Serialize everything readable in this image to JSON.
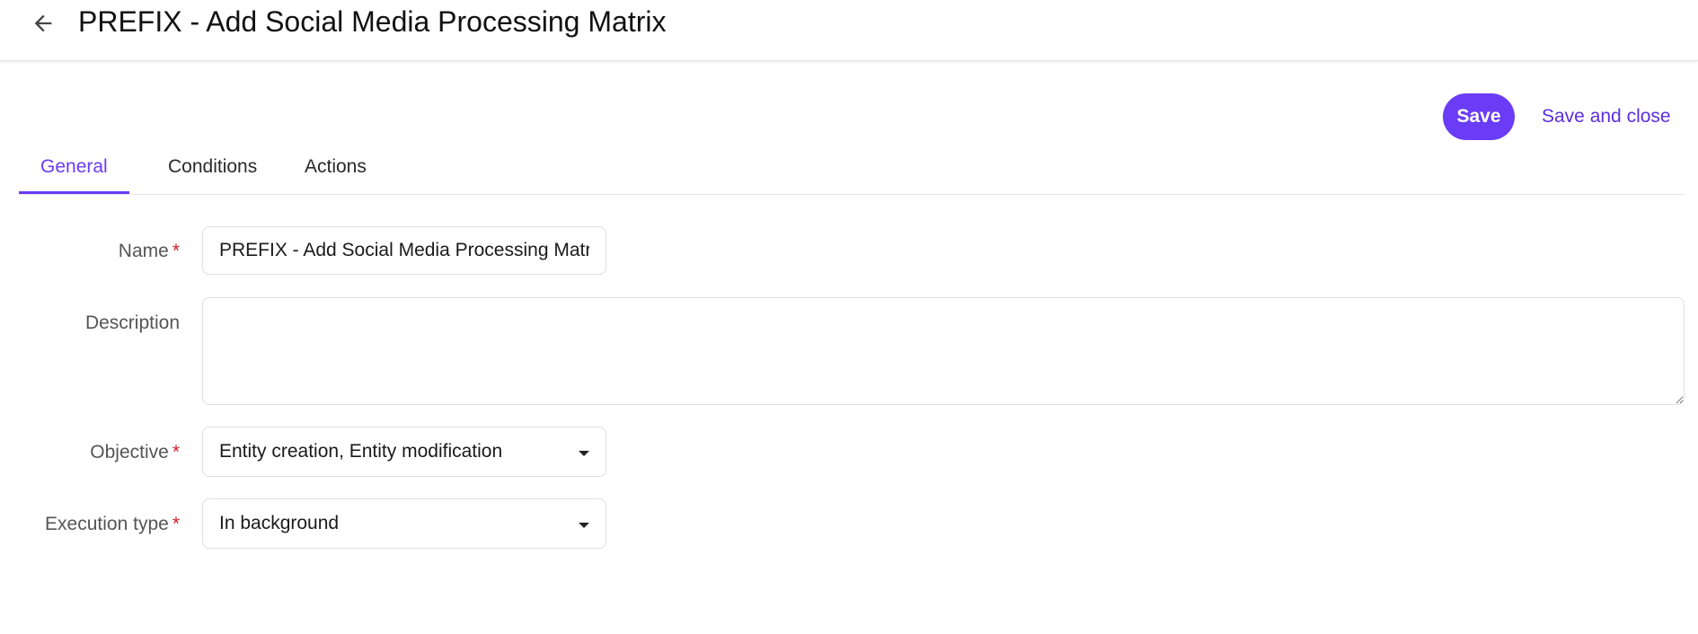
{
  "header": {
    "title": "PREFIX - Add Social Media Processing Matrix",
    "back_icon": "arrow-left-icon"
  },
  "toolbar": {
    "save_label": "Save",
    "save_close_label": "Save and close"
  },
  "tabs": [
    {
      "label": "General",
      "active": true
    },
    {
      "label": "Conditions",
      "active": false
    },
    {
      "label": "Actions",
      "active": false
    }
  ],
  "form": {
    "name": {
      "label": "Name",
      "required_mark": "*",
      "value": "PREFIX - Add Social Media Processing Matrix"
    },
    "description": {
      "label": "Description",
      "value": ""
    },
    "objective": {
      "label": "Objective",
      "required_mark": "*",
      "value": "Entity creation, Entity modification"
    },
    "execution_type": {
      "label": "Execution type",
      "required_mark": "*",
      "value": "In background"
    }
  },
  "colors": {
    "accent": "#6a3cf5",
    "required": "#d11a2a"
  }
}
